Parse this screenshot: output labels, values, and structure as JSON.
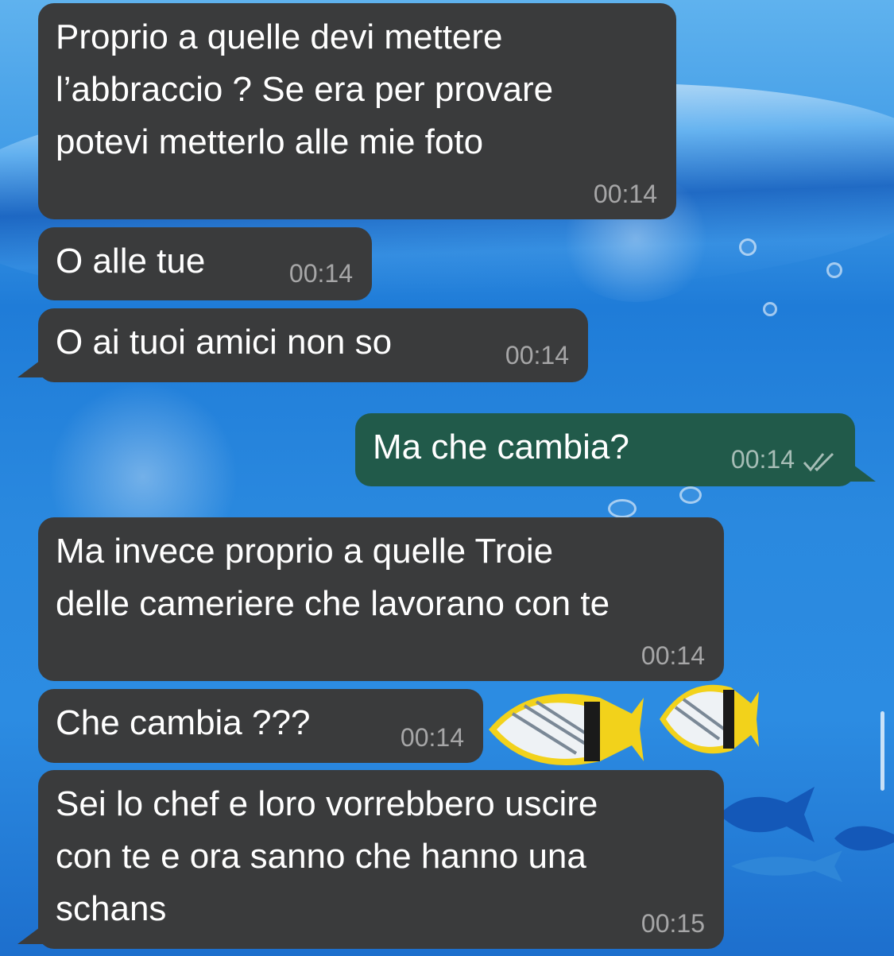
{
  "messages": [
    {
      "direction": "incoming",
      "text": "Proprio a quelle devi mettere\nl’abbraccio ? Se era per provare\npotevi metterlo alle mie foto",
      "time": "00:14"
    },
    {
      "direction": "incoming",
      "text": "O alle tue",
      "time": "00:14"
    },
    {
      "direction": "incoming",
      "text": "O ai tuoi amici non so",
      "time": "00:14"
    },
    {
      "direction": "outgoing",
      "text": "Ma che cambia?",
      "time": "00:14",
      "status": "read"
    },
    {
      "direction": "incoming",
      "text": "Ma invece proprio a quelle Troie\ndelle cameriere che lavorano con te",
      "time": "00:14"
    },
    {
      "direction": "incoming",
      "text": "Che cambia ???",
      "time": "00:14"
    },
    {
      "direction": "incoming",
      "text": "Sei lo chef e loro vorrebbero uscire\ncon te e ora sanno che hanno una\nschans",
      "time": "00:15"
    }
  ],
  "colors": {
    "incoming_bubble": "#3a3b3c",
    "outgoing_bubble": "#215a4a",
    "text": "#ffffff",
    "wallpaper": "#2a89df"
  },
  "icons": {
    "read_receipt": "double-check-icon"
  }
}
